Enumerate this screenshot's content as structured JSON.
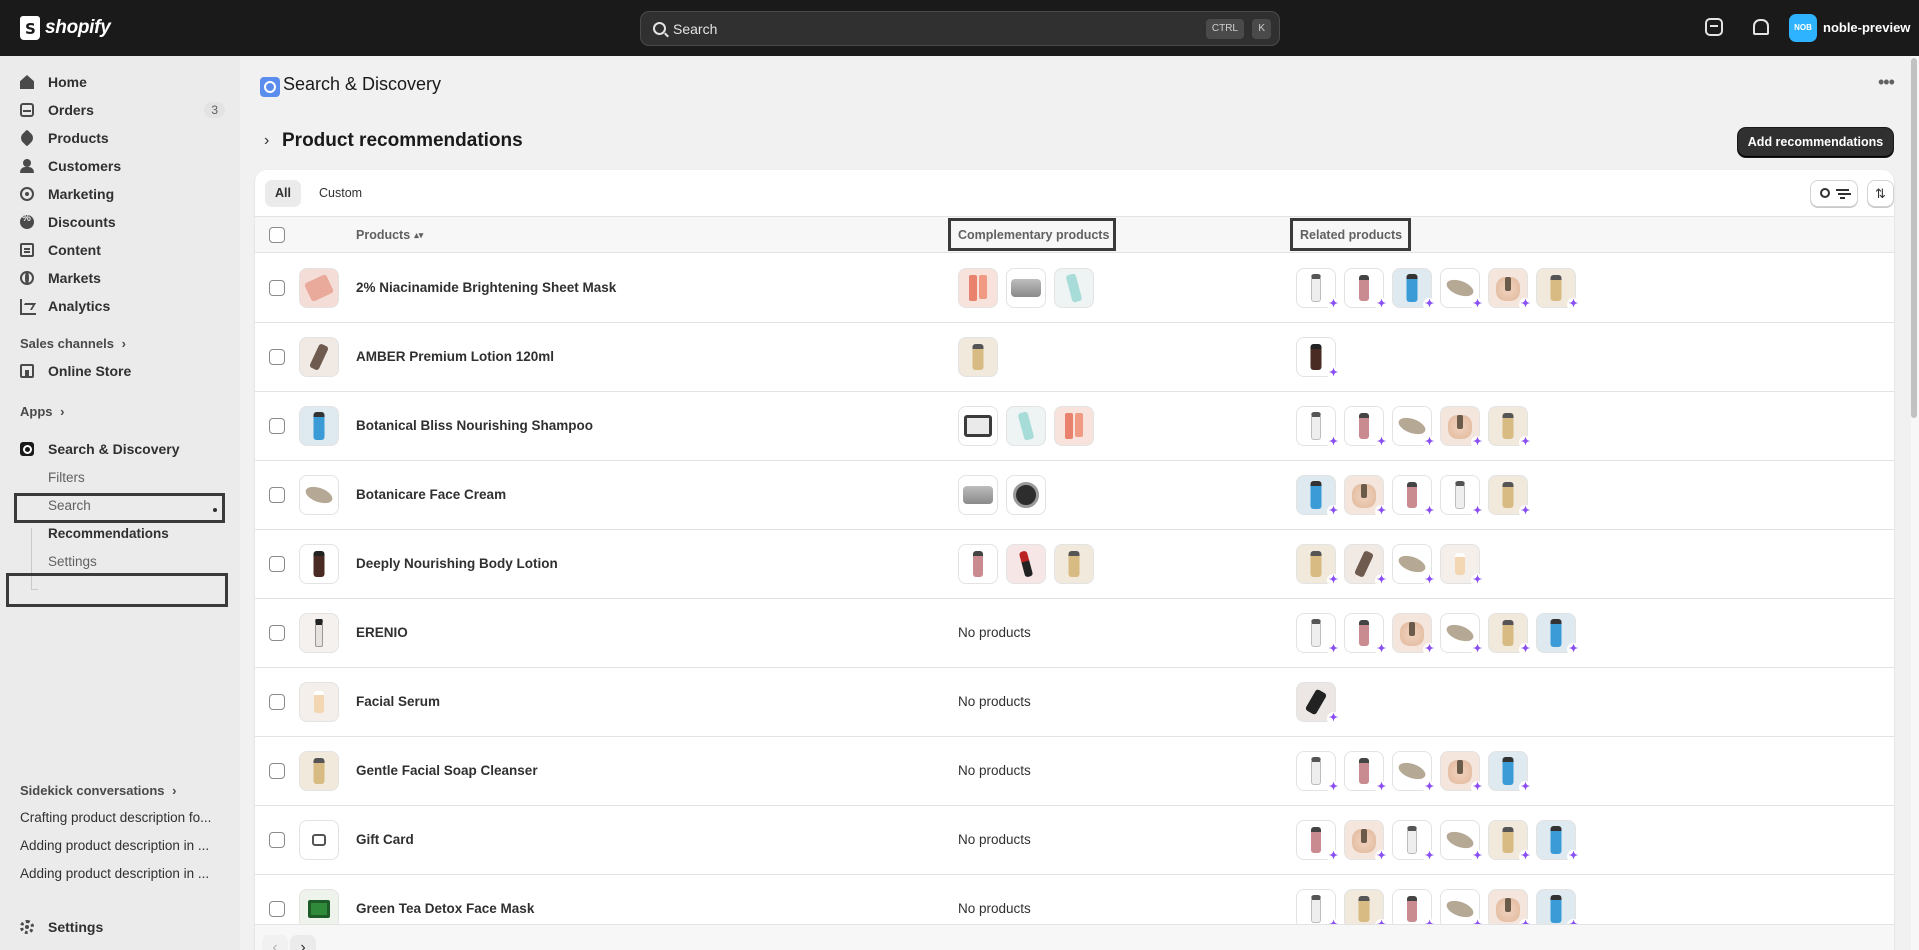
{
  "topbar": {
    "brand": "shopify",
    "search_placeholder": "Search",
    "shortcut_ctrl": "CTRL",
    "shortcut_key": "K",
    "store_initials": "NOB",
    "store_name": "noble-preview"
  },
  "sidebar": {
    "nav": [
      {
        "label": "Home",
        "icon": "home-icon"
      },
      {
        "label": "Orders",
        "icon": "orders-icon",
        "count": "3"
      },
      {
        "label": "Products",
        "icon": "tag-icon"
      },
      {
        "label": "Customers",
        "icon": "person-icon"
      },
      {
        "label": "Marketing",
        "icon": "target-icon"
      },
      {
        "label": "Discounts",
        "icon": "discount-icon"
      },
      {
        "label": "Content",
        "icon": "content-icon"
      },
      {
        "label": "Markets",
        "icon": "globe-icon"
      },
      {
        "label": "Analytics",
        "icon": "chart-icon"
      }
    ],
    "sales_channels_label": "Sales channels",
    "online_store_label": "Online Store",
    "apps_label": "Apps",
    "app_name": "Search & Discovery",
    "app_sub_items": [
      "Filters",
      "Search",
      "Recommendations",
      "Settings"
    ],
    "sidekick_label": "Sidekick conversations",
    "conversations": [
      "Crafting product description fo...",
      "Adding product description in ...",
      "Adding product description in ..."
    ],
    "settings_label": "Settings"
  },
  "main": {
    "app_title": "Search & Discovery",
    "page_title": "Product recommendations",
    "add_button": "Add recommendations",
    "tabs": [
      "All",
      "Custom"
    ],
    "columns": {
      "products": "Products",
      "complementary": "Complementary products",
      "related": "Related products"
    },
    "no_products_text": "No products",
    "rows": [
      {
        "name": "2% Niacinamide Brightening Sheet Mask",
        "thumb": "sheet-mask",
        "complementary": [
          "tube-coral",
          "jar-grey",
          "bottle-teal"
        ],
        "related": [
          "pump-white",
          "bottle-rose",
          "pump-blue",
          "soap-bar",
          "dropper-beige",
          "pump-gold"
        ]
      },
      {
        "name": "AMBER Premium Lotion 120ml",
        "thumb": "dropper-dark",
        "complementary": [
          "pump-gold"
        ],
        "related": [
          "pump-brown"
        ]
      },
      {
        "name": "Botanical Bliss Nourishing Shampoo",
        "thumb": "pump-blue",
        "complementary": [
          "jar-label",
          "bottle-teal",
          "tube-coral"
        ],
        "related": [
          "pump-white",
          "bottle-rose",
          "soap-bar",
          "dropper-beige",
          "pump-gold"
        ]
      },
      {
        "name": "Botanicare Face Cream",
        "thumb": "soap-bar",
        "complementary": [
          "jar-grey",
          "jar-black"
        ],
        "related": [
          "pump-blue",
          "dropper-beige",
          "bottle-rose",
          "pump-white",
          "pump-gold"
        ]
      },
      {
        "name": "Deeply Nourishing Body Lotion",
        "thumb": "pump-brown",
        "complementary": [
          "bottle-rose",
          "lipstick-red",
          "pump-gold"
        ],
        "related": [
          "pump-gold",
          "dropper-dark",
          "soap-bar",
          "serum-cream"
        ]
      },
      {
        "name": "ERENIO",
        "thumb": "dropper-clear",
        "complementary": [],
        "related": [
          "pump-white",
          "bottle-rose",
          "dropper-beige",
          "soap-bar",
          "pump-gold",
          "pump-blue"
        ]
      },
      {
        "name": "Facial Serum",
        "thumb": "serum-cream",
        "complementary": [],
        "related": [
          "dropper-black"
        ]
      },
      {
        "name": "Gentle Facial Soap Cleanser",
        "thumb": "pump-gold",
        "complementary": [],
        "related": [
          "pump-white",
          "bottle-rose",
          "soap-bar",
          "dropper-beige",
          "pump-blue"
        ]
      },
      {
        "name": "Gift Card",
        "thumb": "gift-card",
        "complementary": [],
        "related": [
          "bottle-rose",
          "dropper-beige",
          "pump-white",
          "soap-bar",
          "pump-gold",
          "pump-blue"
        ]
      },
      {
        "name": "Green Tea Detox Face Mask",
        "thumb": "mask-green",
        "complementary": [],
        "related": [
          "pump-white",
          "pump-gold",
          "bottle-rose",
          "soap-bar",
          "dropper-beige",
          "pump-blue"
        ]
      }
    ]
  },
  "colors": {
    "topbar": "#1a1a1a",
    "sidebar": "#ebebeb",
    "primary_button": "#303030",
    "sparkle": "#8a4ff2",
    "store_avatar": "#2db3ff"
  }
}
